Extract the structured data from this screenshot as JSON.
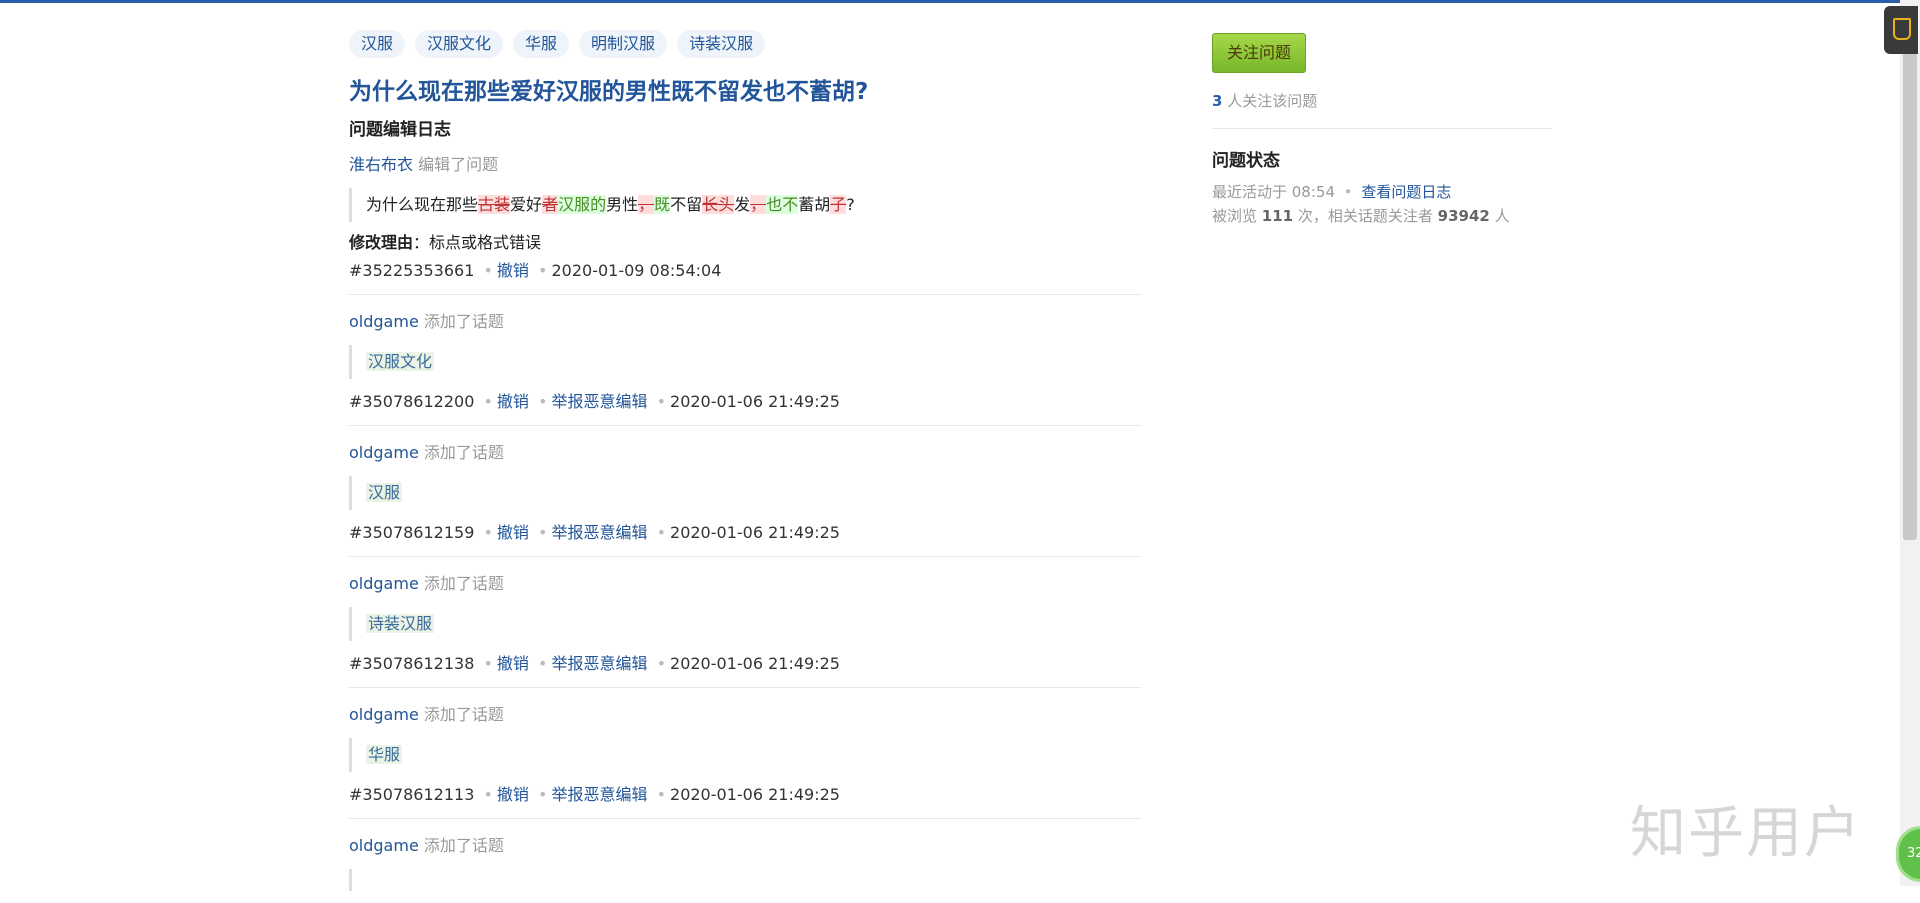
{
  "tags": [
    "汉服",
    "汉服文化",
    "华服",
    "明制汉服",
    "诗装汉服"
  ],
  "question_title": "为什么现在那些爱好汉服的男性既不留发也不蓄胡?",
  "log_heading": "问题编辑日志",
  "first_entry": {
    "actor": "淮右布衣",
    "action": "编辑了问题",
    "diff": [
      {
        "t": "为什么现在那些",
        "k": "plain"
      },
      {
        "t": "古装",
        "k": "del"
      },
      {
        "t": "爱好",
        "k": "plain"
      },
      {
        "t": "者",
        "k": "del"
      },
      {
        "t": "汉服的",
        "k": "ins"
      },
      {
        "t": "男性",
        "k": "plain"
      },
      {
        "t": "，",
        "k": "del"
      },
      {
        "t": "既",
        "k": "ins"
      },
      {
        "t": "不留",
        "k": "plain"
      },
      {
        "t": "长头",
        "k": "del"
      },
      {
        "t": "发",
        "k": "plain"
      },
      {
        "t": "，",
        "k": "del"
      },
      {
        "t": "也不",
        "k": "ins"
      },
      {
        "t": "蓄胡",
        "k": "plain"
      },
      {
        "t": "子",
        "k": "del"
      },
      {
        "t": "?",
        "k": "plain"
      }
    ],
    "reason_label": "修改理由",
    "reason_text": "：标点或格式错误",
    "id": "#35225353661",
    "undo": "撤销",
    "time": "2020-01-09 08:54:04"
  },
  "topic_entries": [
    {
      "actor": "oldgame",
      "action": "添加了话题",
      "topic": "汉服文化",
      "id": "#35078612200",
      "undo": "撤销",
      "report": "举报恶意编辑",
      "time": "2020-01-06 21:49:25"
    },
    {
      "actor": "oldgame",
      "action": "添加了话题",
      "topic": "汉服",
      "id": "#35078612159",
      "undo": "撤销",
      "report": "举报恶意编辑",
      "time": "2020-01-06 21:49:25"
    },
    {
      "actor": "oldgame",
      "action": "添加了话题",
      "topic": "诗装汉服",
      "id": "#35078612138",
      "undo": "撤销",
      "report": "举报恶意编辑",
      "time": "2020-01-06 21:49:25"
    },
    {
      "actor": "oldgame",
      "action": "添加了话题",
      "topic": "华服",
      "id": "#35078612113",
      "undo": "撤销",
      "report": "举报恶意编辑",
      "time": "2020-01-06 21:49:25"
    },
    {
      "actor": "oldgame",
      "action": "添加了话题",
      "topic": "",
      "id": "",
      "undo": "",
      "report": "",
      "time": ""
    }
  ],
  "sidebar": {
    "follow_button": "关注问题",
    "followers_count": "3",
    "followers_text": " 人关注该问题",
    "status_title": "问题状态",
    "last_active": "最近活动于 08:54",
    "view_log_link": "查看问题日志",
    "views_prefix": "被浏览 ",
    "views_count": "111",
    "views_mid": " 次，相关话题关注者 ",
    "topic_followers": "93942",
    "views_suffix": " 人"
  },
  "watermark": "知乎用户",
  "badge_text": "32",
  "colors": {
    "link": "#225599",
    "follow_green": "#8fc83a",
    "deleted_bg": "#ffdddd",
    "inserted_bg": "#ddffdd"
  }
}
